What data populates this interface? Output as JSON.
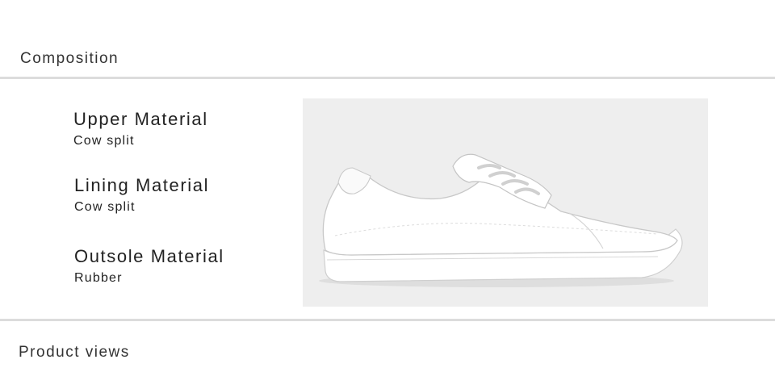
{
  "sections": {
    "composition_title": "Composition",
    "product_views_title": "Product views"
  },
  "specs": {
    "upper": {
      "label": "Upper Material",
      "value": "Cow split"
    },
    "lining": {
      "label": "Lining Material",
      "value": "Cow split"
    },
    "outsole": {
      "label": "Outsole Material",
      "value": "Rubber"
    }
  },
  "product_image": {
    "subject": "white-leather-sneaker-side-view",
    "background_color": "#eeeeee",
    "shoe_color": "#ffffff"
  }
}
